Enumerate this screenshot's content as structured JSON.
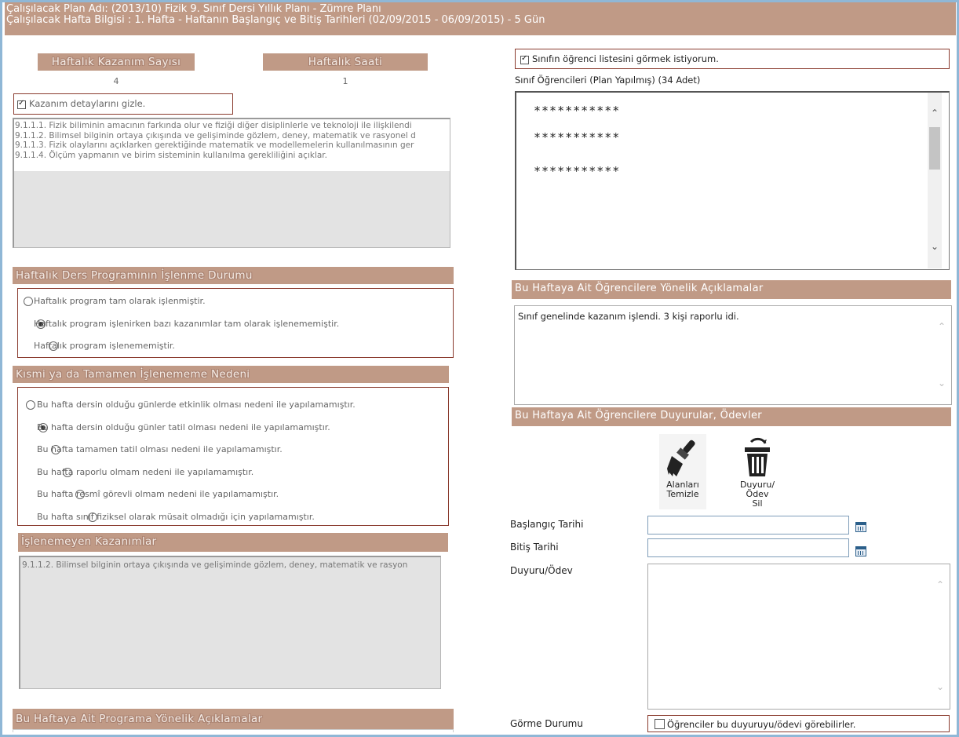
{
  "header": {
    "line1": "Çalışılacak Plan Adı: (2013/10) Fizik 9. Sınıf Dersi Yıllık Planı - Zümre Planı",
    "line2": "Çalışılacak Hafta Bilgisi : 1. Hafta - Haftanın Başlangıç ve Bitiş Tarihleri (02/09/2015 - 06/09/2015) - 5 Gün"
  },
  "left": {
    "kazanim_sayisi_label": "Haftalık Kazanım Sayısı",
    "kazanim_sayisi_value": "4",
    "haftalik_saat_label": "Haftalık Saati",
    "haftalik_saat_value": "1",
    "hide_details_label": "Kazanım detaylarını gizle.",
    "hide_details_checked": true,
    "kazanimlar": [
      "9.1.1.1. Fizik biliminin amacının farkında olur ve fiziği diğer disiplinlerle ve teknoloji ile ilişkilendi",
      "9.1.1.2. Bilimsel bilginin ortaya çıkışında ve gelişiminde gözlem, deney, matematik ve rasyonel d",
      "9.1.1.3. Fizik olaylarını açıklarken gerektiğinde matematik ve modellemelerin kullanılmasının ger",
      "9.1.1.4. Ölçüm yapmanın ve birim sisteminin kullanılma gerekliliğini açıklar."
    ],
    "isleme_durumu_title": "Haftalık Ders Programının İşlenme Durumu",
    "isleme_durumu_options": [
      {
        "label": "Haftalık program tam olarak işlenmiştir.",
        "selected": false
      },
      {
        "label": "Haftalık program işlenirken bazı kazanımlar tam olarak işlenememiştir.",
        "selected": true
      },
      {
        "label": "Haftalık program işlenememiştir.",
        "selected": false
      }
    ],
    "neden_title": "Kısmi ya da Tamamen İşlenememe Nedeni",
    "neden_options": [
      {
        "label": "Bu hafta dersin olduğu günlerde etkinlik olması nedeni ile yapılamamıştır.",
        "selected": false
      },
      {
        "label": "Bu hafta dersin olduğu günler tatil olması nedeni ile yapılamamıştır.",
        "selected": true
      },
      {
        "label": "Bu hafta tamamen tatil olması nedeni ile yapılamamıştır.",
        "selected": false
      },
      {
        "label": "Bu hafta raporlu olmam nedeni ile yapılamamıştır.",
        "selected": false
      },
      {
        "label": "Bu hafta resmî görevli olmam nedeni ile yapılamamıştır.",
        "selected": false
      },
      {
        "label": "Bu hafta sınıf fiziksel olarak müsait olmadığı için yapılamamıştır.",
        "selected": false
      }
    ],
    "islenemeyen_title": "İşlenemeyen Kazanımlar",
    "islenemeyen_text": "9.1.1.2. Bilimsel bilginin ortaya çıkışında ve gelişiminde gözlem, deney, matematik ve rasyon",
    "programa_aciklama_title": "Bu Haftaya Ait Programa Yönelik Açıklamalar"
  },
  "right": {
    "show_students_label": "Sınıfın öğrenci listesini görmek istiyorum.",
    "show_students_checked": true,
    "students_caption": "Sınıf Öğrencileri (Plan Yapılmış) (34 Adet)",
    "students": [
      "***********",
      "***********",
      "***********"
    ],
    "ogrenci_aciklama_title": "Bu Haftaya Ait Öğrencilere Yönelik Açıklamalar",
    "ogrenci_aciklama_text": "Sınıf genelinde kazanım işlendi. 3 kişi raporlu idi.",
    "duyuru_title": "Bu Haftaya Ait Öğrencilere Duyurular, Ödevler",
    "clear_button_line1": "Alanları",
    "clear_button_line2": "Temizle",
    "delete_button_line1": "Duyuru/Ödev",
    "delete_button_line2": "Sil",
    "baslangic_label": "Başlangıç Tarihi",
    "baslangic_value": "",
    "bitis_label": "Bitiş Tarihi",
    "bitis_value": "",
    "duyuru_label": "Duyuru/Ödev",
    "duyuru_value": "",
    "gorme_label": "Görme Durumu",
    "gorme_checkbox_label": "Öğrenciler bu duyuruyu/ödevi görebilirler.",
    "gorme_checked": false
  }
}
